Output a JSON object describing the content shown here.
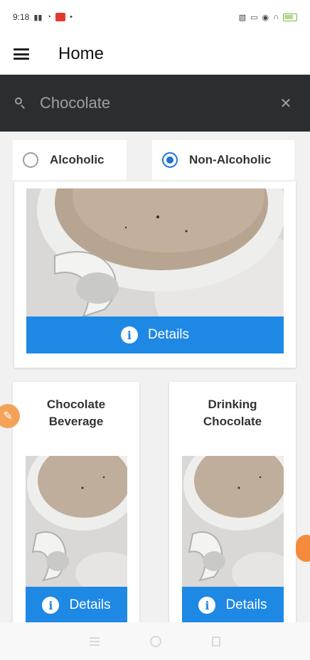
{
  "status_bar": {
    "time": "9:18",
    "left_icons": [
      "signal-icon",
      "wifi-icon",
      "notification-red-icon",
      "dot-icon"
    ],
    "right_icons": [
      "nfc-icon",
      "cast-icon",
      "eye-icon",
      "headphones-icon",
      "battery-icon"
    ]
  },
  "app_bar": {
    "title": "Home"
  },
  "search": {
    "value": "Chocolate",
    "clear_icon": "close-icon"
  },
  "filter": {
    "options": [
      {
        "label": "Alcoholic",
        "selected": false
      },
      {
        "label": "Non-Alcoholic",
        "selected": true
      }
    ]
  },
  "cards": [
    {
      "title": "",
      "details_label": "Details"
    },
    {
      "title_line1": "Chocolate",
      "title_line2": "Beverage",
      "details_label": "Details"
    },
    {
      "title_line1": "Drinking",
      "title_line2": "Chocolate",
      "details_label": "Details"
    }
  ],
  "colors": {
    "accent": "#1e88e5",
    "radio_selected": "#1976d2",
    "search_bg": "#2b2e31",
    "fab": "#f4a259"
  }
}
